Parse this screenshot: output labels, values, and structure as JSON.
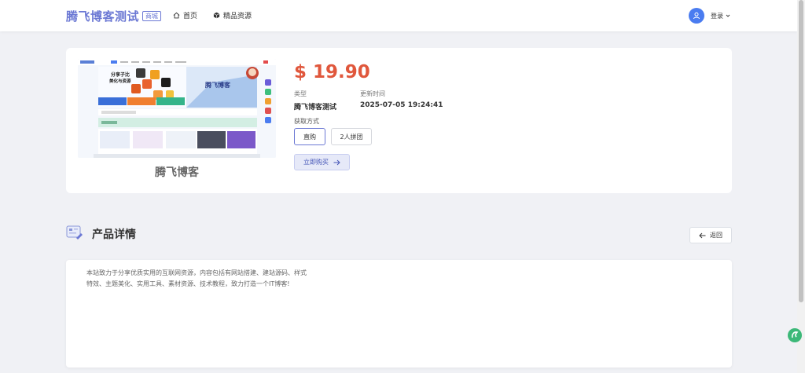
{
  "header": {
    "brand_title": "腾飞博客测试",
    "brand_badge": "商城",
    "nav": [
      {
        "label": "首页",
        "icon": "home-icon"
      },
      {
        "label": "精品资源",
        "icon": "cube-icon"
      }
    ],
    "login_label": "登录"
  },
  "product": {
    "image_caption": "腾飞博客",
    "price": "$ 19.90",
    "type_label": "类型",
    "type_value": "腾飞博客测试",
    "updated_label": "更新时间",
    "updated_value": "2025-07-05 19:24:41",
    "acquire_label": "获取方式",
    "options": [
      "直购",
      "2人拼团"
    ],
    "selected_option": "直购",
    "buy_label": "立即购买"
  },
  "thumbnail": {
    "hero_lines": [
      "分享子比",
      "美化与资源"
    ],
    "banner_text": "腾飞博客"
  },
  "details": {
    "title": "产品详情",
    "back_label": "返回",
    "text_lines": [
      "本站致力于分享优质实用的互联网资源，内容包括有网站搭建、建站源码、样式",
      "特效、主题美化、实用工具、素材资源、技术教程，致力打造一个IT博客!"
    ]
  },
  "colors": {
    "brand": "#6b78d4",
    "price": "#e0573c",
    "avatar": "#4a7cf0"
  }
}
